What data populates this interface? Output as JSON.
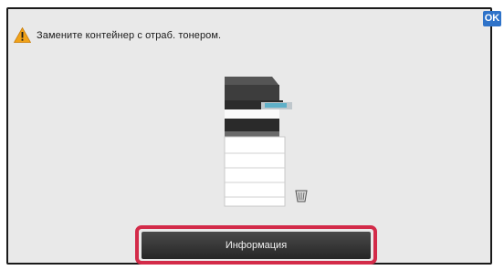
{
  "alert": {
    "icon": "warning-icon",
    "message": "Замените контейнер с отраб. тонером."
  },
  "ok_button": {
    "label": "OK",
    "color": "#2f73c9"
  },
  "illustration": {
    "icon": "printer-icon",
    "waste_icon": "waste-toner-box-icon"
  },
  "info_button": {
    "label": "Информация",
    "highlight_color": "#d32b49"
  }
}
